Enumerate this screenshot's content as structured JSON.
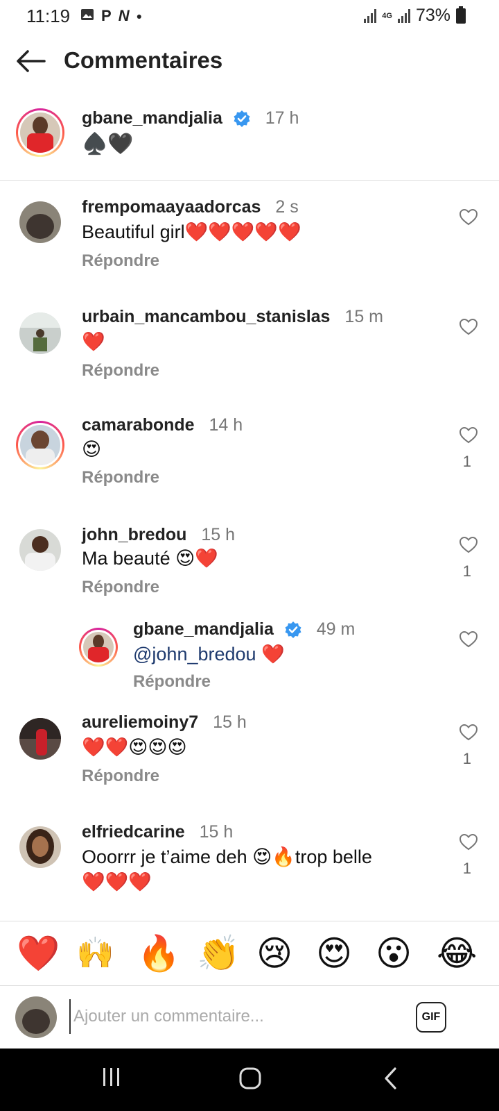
{
  "status_bar": {
    "time": "11:19",
    "left_icons": [
      "gallery-icon",
      "p-icon",
      "n-icon",
      "dot"
    ],
    "network": "4G",
    "battery": "73%"
  },
  "header": {
    "title": "Commentaires"
  },
  "caption": {
    "username": "gbane_mandjalia",
    "time": "17 h",
    "text": "♠️🖤"
  },
  "comments": [
    {
      "username": "frempomaayaadorcas",
      "time": "2 s",
      "text": "Beautiful girl❤️❤️❤️❤️❤️",
      "reply": "Répondre",
      "likes": ""
    },
    {
      "username": "urbain_mancambou_stanislas",
      "time": "15 m",
      "text": "❤️",
      "reply": "Répondre",
      "likes": ""
    },
    {
      "username": "camarabonde",
      "time": "14 h",
      "text": "😍",
      "reply": "Répondre",
      "likes": "1"
    },
    {
      "username": "john_bredou",
      "time": "15 h",
      "text": "Ma beauté 😍❤️",
      "reply": "Répondre",
      "likes": "1"
    },
    {
      "username": "aureliemoiny7",
      "time": "15 h",
      "text": "❤️❤️😍😍😍",
      "reply": "Répondre",
      "likes": "1"
    },
    {
      "username": "elfriedcarine",
      "time": "15 h",
      "text": "Ooorrr je t’aime deh 😍🔥trop belle",
      "text2": "❤️❤️❤️",
      "reply": "Répondre",
      "likes": "1"
    }
  ],
  "reply_thread": {
    "username": "gbane_mandjalia",
    "time": "49 m",
    "mention": "@john_bredou",
    "text": " ❤️",
    "reply": "Répondre"
  },
  "reactions": [
    "❤️",
    "🙌",
    "🔥",
    "👏",
    "😢",
    "😍",
    "😮",
    "😂"
  ],
  "input": {
    "placeholder": "Ajouter un commentaire...",
    "gif_label": "GIF"
  },
  "colors": {
    "verified": "#3897f0",
    "muted_text": "#777777",
    "reply_text": "#8a8a8a",
    "mention": "#1e3a6e"
  }
}
